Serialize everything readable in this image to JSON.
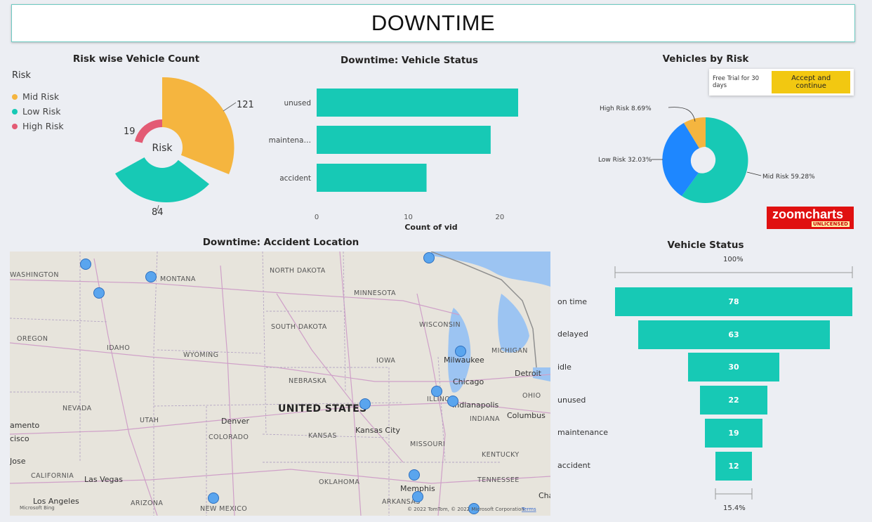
{
  "page_title": "DOWNTIME",
  "colors": {
    "teal": "#17c9b5",
    "orange": "#f5b53f",
    "pink": "#e35b74",
    "blue": "#1e87ff",
    "zoomchartsRed": "#e01010",
    "accept": "#f2c811"
  },
  "risk_count": {
    "title": "Risk wise Vehicle Count",
    "legend_title": "Risk",
    "legend": [
      "Mid Risk",
      "Low Risk",
      "High Risk"
    ],
    "center_label": "Risk",
    "labels": {
      "mid": "121",
      "low": "84",
      "high": "19"
    },
    "chart_data": {
      "type": "pie",
      "categories": [
        "Mid Risk",
        "Low Risk",
        "High Risk"
      ],
      "values": [
        121,
        84,
        19
      ]
    }
  },
  "vehicle_status_bar": {
    "title": "Downtime: Vehicle Status",
    "xlabel": "Count of vid",
    "tick_labels": [
      "0",
      "10",
      "20"
    ],
    "category_labels": [
      "unused",
      "maintena…",
      "accident"
    ],
    "chart_data": {
      "type": "bar",
      "categories": [
        "unused",
        "maintenance",
        "accident"
      ],
      "values": [
        22,
        19,
        12
      ],
      "xlim": [
        0,
        22
      ]
    }
  },
  "vehicles_by_risk": {
    "title": "Vehicles by Risk",
    "trial_text": "Free Trial for 30 days",
    "accept_label": "Accept and continue",
    "slice_labels": [
      "High Risk 8.69%",
      "Low Risk 32.03%",
      "Mid Risk 59.28%"
    ],
    "badge_text": "zoomcharts",
    "badge_sub": "UNLICENSED",
    "chart_data": {
      "type": "pie",
      "categories": [
        "Mid Risk",
        "Low Risk",
        "High Risk"
      ],
      "values": [
        59.28,
        32.03,
        8.69
      ]
    }
  },
  "map": {
    "title": "Downtime: Accident Location",
    "labels": [
      "WASHINGTON",
      "MONTANA",
      "NORTH DAKOTA",
      "MINNESOTA",
      "SOUTH DAKOTA",
      "WISCONSIN",
      "OREGON",
      "IDAHO",
      "WYOMING",
      "MICHIGAN",
      "IOWA",
      "Milwaukee",
      "Detroit",
      "NEBRASKA",
      "Chicago",
      "ILLINOIS",
      "Indianapolis",
      "OHIO",
      "UNITED STATES",
      "NEVADA",
      "UTAH",
      "Denver",
      "Kansas City",
      "INDIANA",
      "Columbus",
      "amento",
      "COLORADO",
      "KANSAS",
      "MISSOURI",
      "cisco",
      "Jose",
      "KENTUCKY",
      "CALIFORNIA",
      "Las Vegas",
      "OKLAHOMA",
      "TENNESSEE",
      "Memphis",
      "Los Angeles",
      "ARIZONA",
      "NEW MEXICO",
      "ARKANSAS",
      "Cha"
    ],
    "copyright": "© 2022 TomTom, © 2022 Microsoft Corporation",
    "terms": "Terms",
    "bing": "Microsoft Bing"
  },
  "funnel": {
    "title": "Vehicle Status",
    "top_pct": "100%",
    "bottom_pct": "15.4%",
    "chart_data": {
      "type": "bar",
      "categories": [
        "on time",
        "delayed",
        "idle",
        "unused",
        "maintenance",
        "accident"
      ],
      "values": [
        78,
        63,
        30,
        22,
        19,
        12
      ]
    }
  }
}
